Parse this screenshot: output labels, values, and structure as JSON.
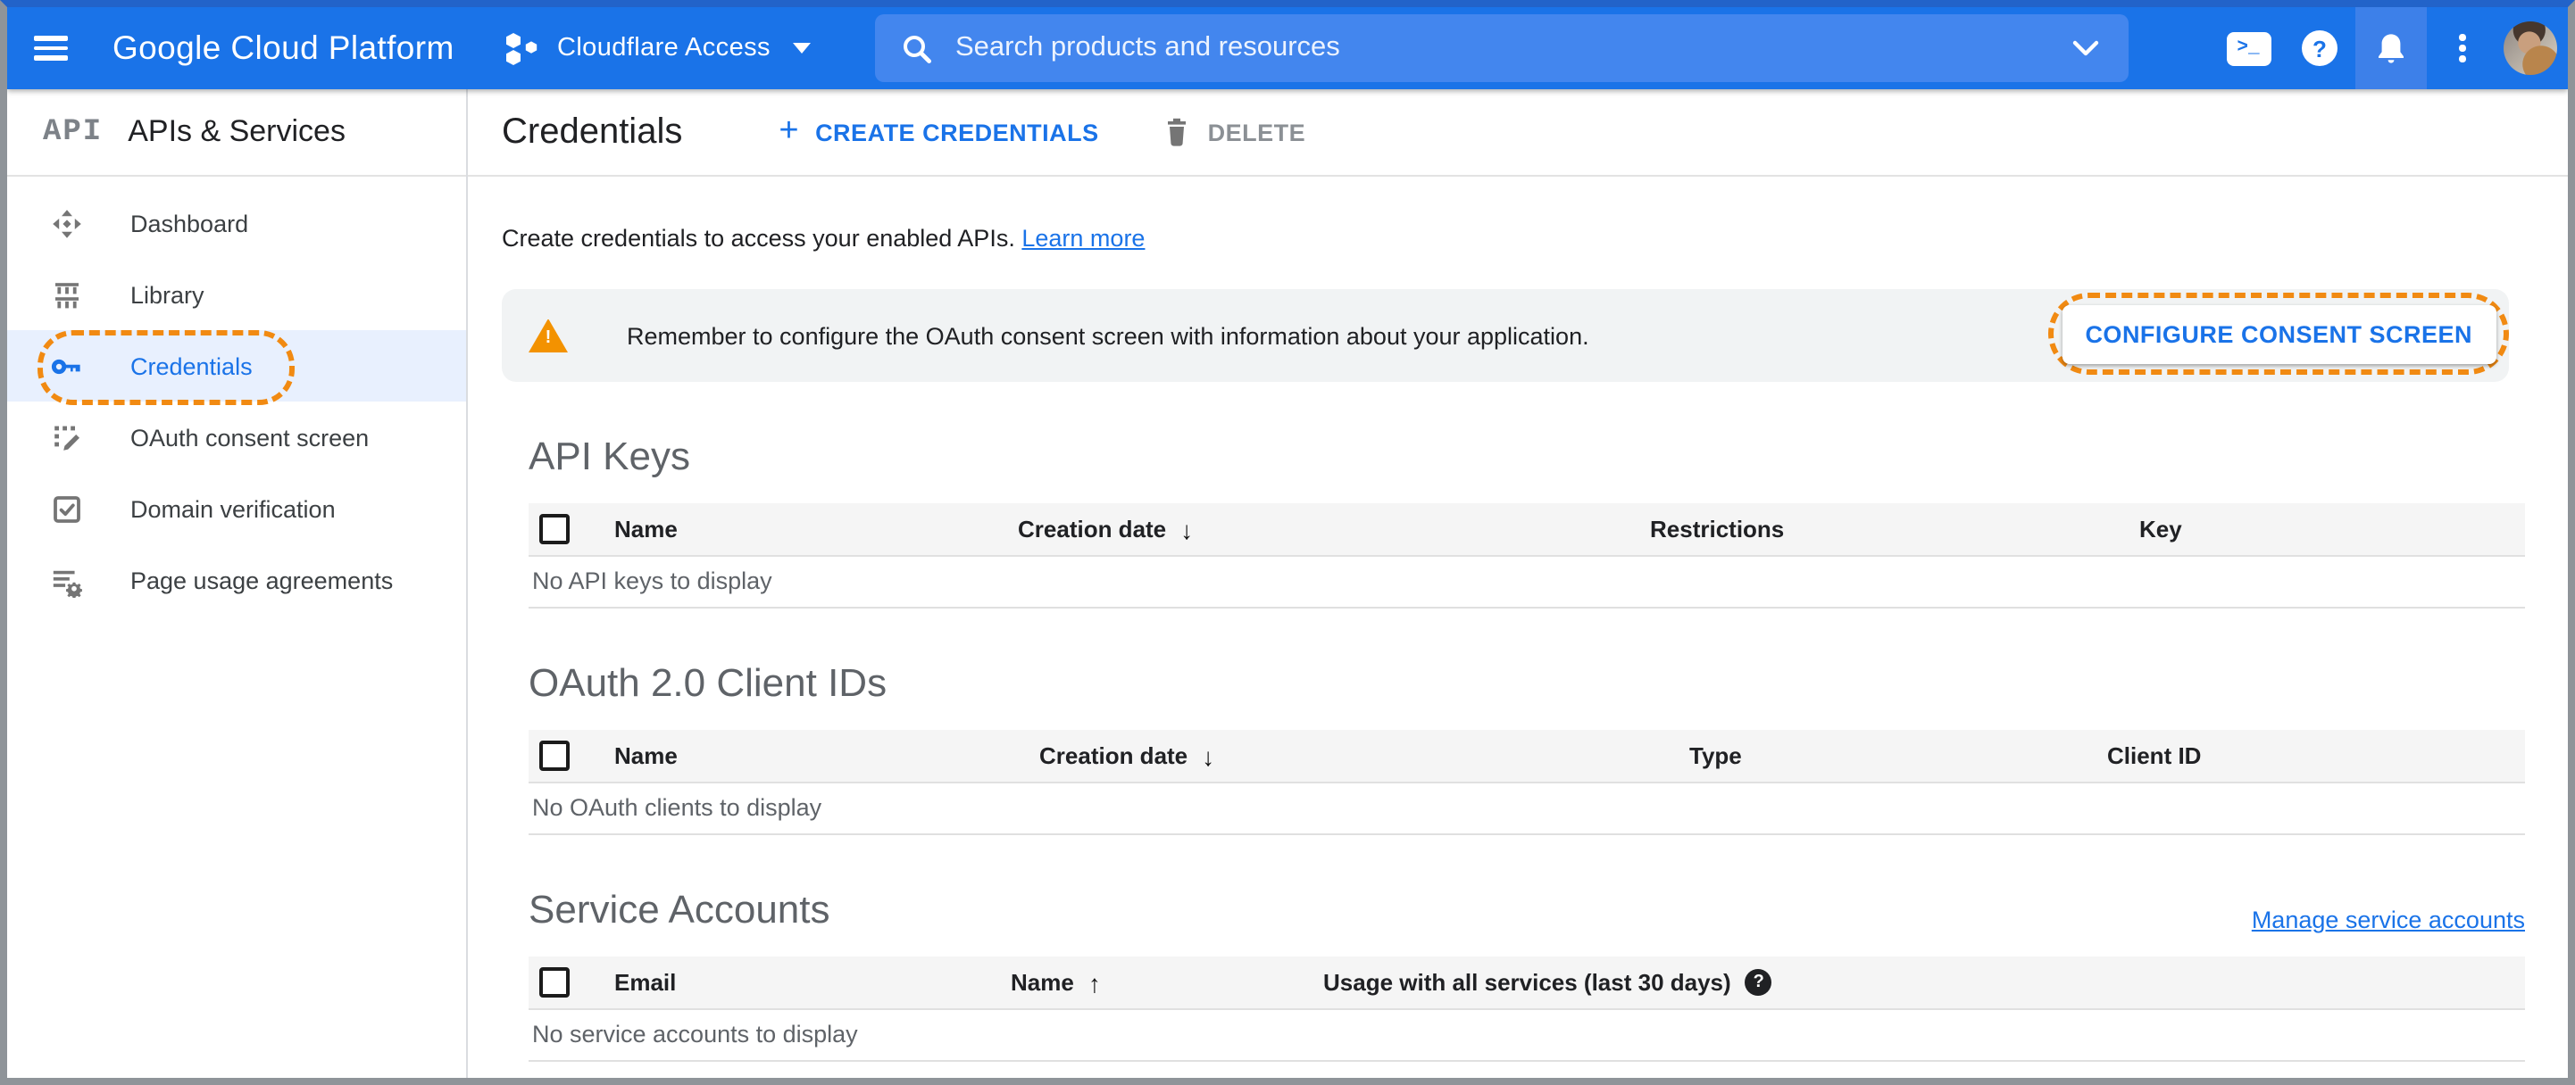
{
  "colors": {
    "header_blue": "#1a73e8",
    "accent_blue": "#1a73e8",
    "annotation_orange": "#f18a12",
    "warning_orange": "#f39200",
    "selected_item_bg": "#e8f0fe",
    "banner_bg": "#f1f3f4",
    "table_header_bg": "#f5f5f5"
  },
  "icons": {
    "plus": "+",
    "sort_desc": "↓",
    "sort_asc": "↑",
    "shell_glyph": ">_",
    "help_glyph": "?",
    "usage_help_glyph": "?",
    "warning_glyph": "!"
  },
  "topbar": {
    "product_name": "Google Cloud Platform",
    "project": {
      "name": "Cloudflare Access"
    },
    "search": {
      "placeholder": "Search products and resources"
    }
  },
  "sidebar": {
    "logo": "API",
    "title": "APIs & Services",
    "items": [
      {
        "label": "Dashboard",
        "icon": "dashboard-icon",
        "selected": false
      },
      {
        "label": "Library",
        "icon": "library-icon",
        "selected": false
      },
      {
        "label": "Credentials",
        "icon": "key-icon",
        "selected": true,
        "annotated": true
      },
      {
        "label": "OAuth consent screen",
        "icon": "consent-icon",
        "selected": false
      },
      {
        "label": "Domain verification",
        "icon": "domain-verification-icon",
        "selected": false
      },
      {
        "label": "Page usage agreements",
        "icon": "page-usage-icon",
        "selected": false
      }
    ]
  },
  "page": {
    "title": "Credentials",
    "actions": {
      "create": "CREATE CREDENTIALS",
      "delete": "DELETE"
    },
    "intro": "Create credentials to access your enabled APIs.",
    "learn_more": "Learn more",
    "banner": {
      "text": "Remember to configure the OAuth consent screen with information about your application.",
      "button": "CONFIGURE CONSENT SCREEN"
    },
    "sections": {
      "api_keys": {
        "title": "API Keys",
        "columns": [
          "Name",
          "Creation date",
          "Restrictions",
          "Key"
        ],
        "sort_column": "Creation date",
        "sort_direction": "desc",
        "empty": "No API keys to display"
      },
      "oauth_clients": {
        "title": "OAuth 2.0 Client IDs",
        "columns": [
          "Name",
          "Creation date",
          "Type",
          "Client ID"
        ],
        "sort_column": "Creation date",
        "sort_direction": "desc",
        "empty": "No OAuth clients to display"
      },
      "service_accounts": {
        "title": "Service Accounts",
        "manage_link": "Manage service accounts",
        "columns": [
          "Email",
          "Name",
          "Usage with all services (last 30 days)"
        ],
        "sort_column": "Name",
        "sort_direction": "asc",
        "empty": "No service accounts to display"
      }
    }
  }
}
